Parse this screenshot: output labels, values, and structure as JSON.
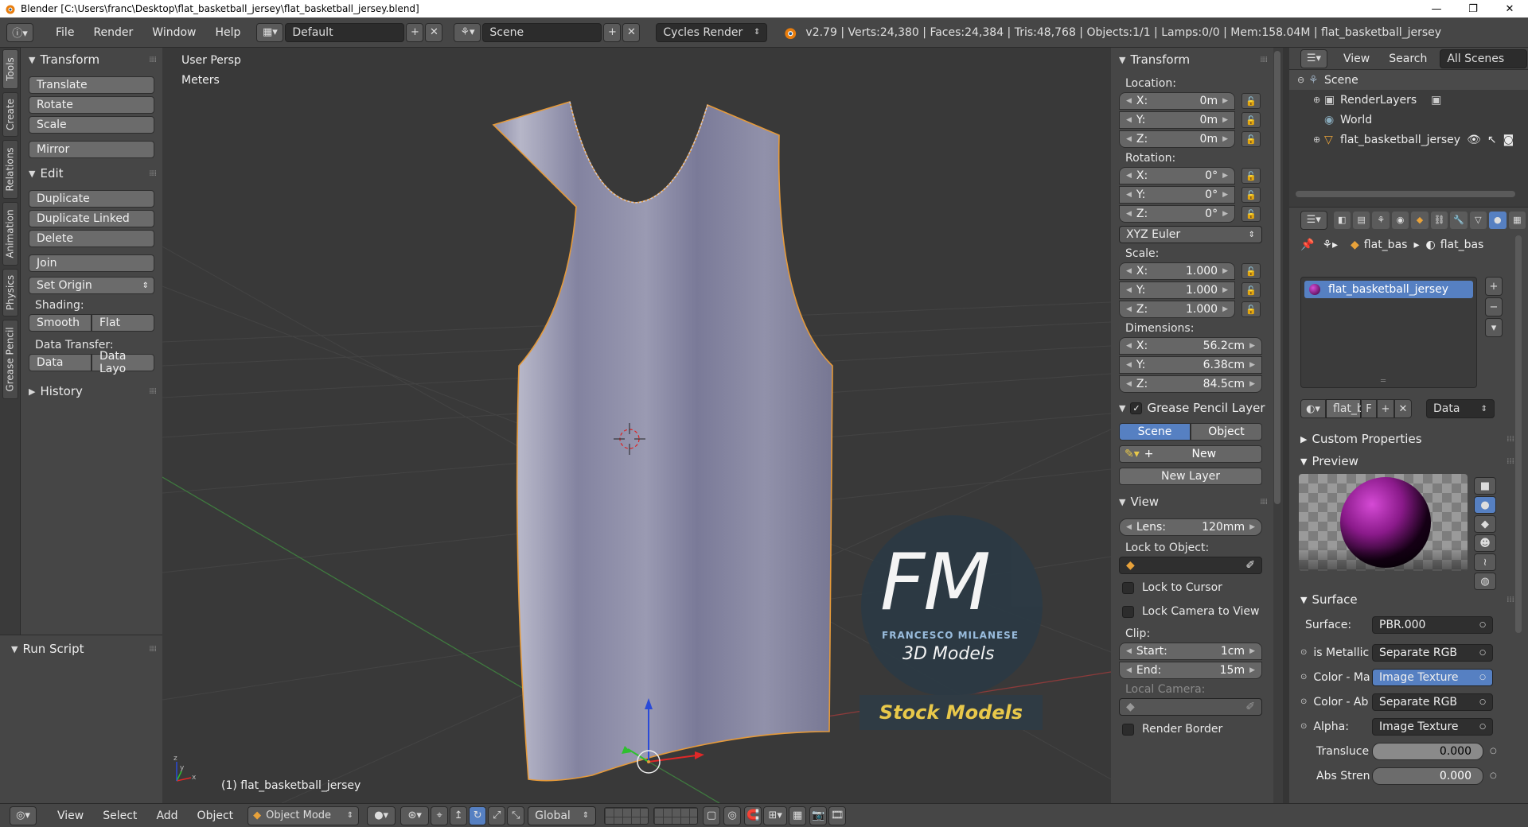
{
  "window": {
    "title": "Blender [C:\\Users\\franc\\Desktop\\flat_basketball_jersey\\flat_basketball_jersey.blend]",
    "minimize": "—",
    "maximize": "❐",
    "close": "✕"
  },
  "info_header": {
    "menus": [
      "File",
      "Render",
      "Window",
      "Help"
    ],
    "layout": "Default",
    "scene": "Scene",
    "engine": "Cycles Render",
    "stats": "v2.79 | Verts:24,380 | Faces:24,384 | Tris:48,768 | Objects:1/1 | Lamps:0/0 | Mem:158.04M | flat_basketball_jersey"
  },
  "tool_tabs": [
    "Tools",
    "Create",
    "Relations",
    "Animation",
    "Physics",
    "Grease Pencil"
  ],
  "tool_shelf": {
    "transform": {
      "title": "Transform",
      "buttons": [
        "Translate",
        "Rotate",
        "Scale"
      ],
      "mirror": "Mirror"
    },
    "edit": {
      "title": "Edit",
      "duplicate": "Duplicate",
      "duplicate_linked": "Duplicate Linked",
      "delete": "Delete",
      "join": "Join",
      "set_origin": "Set Origin",
      "shading_label": "Shading:",
      "smooth": "Smooth",
      "flat": "Flat",
      "data_transfer_label": "Data Transfer:",
      "data": "Data",
      "data_layout": "Data Layo"
    },
    "history": "History",
    "run_script": "Run Script"
  },
  "viewport": {
    "view_name": "User Persp",
    "units": "Meters",
    "object_label": "(1) flat_basketball_jersey",
    "watermark_letters": "FM",
    "watermark_name": "FRANCESCO MILANESE",
    "watermark_sub": "3D Models",
    "watermark_banner": "Stock Models"
  },
  "n_panel": {
    "transform_title": "Transform",
    "location_label": "Location:",
    "location": [
      {
        "k": "X:",
        "v": "0m"
      },
      {
        "k": "Y:",
        "v": "0m"
      },
      {
        "k": "Z:",
        "v": "0m"
      }
    ],
    "rotation_label": "Rotation:",
    "rotation": [
      {
        "k": "X:",
        "v": "0°"
      },
      {
        "k": "Y:",
        "v": "0°"
      },
      {
        "k": "Z:",
        "v": "0°"
      }
    ],
    "rotation_mode": "XYZ Euler",
    "scale_label": "Scale:",
    "scale": [
      {
        "k": "X:",
        "v": "1.000"
      },
      {
        "k": "Y:",
        "v": "1.000"
      },
      {
        "k": "Z:",
        "v": "1.000"
      }
    ],
    "dimensions_label": "Dimensions:",
    "dimensions": [
      {
        "k": "X:",
        "v": "56.2cm"
      },
      {
        "k": "Y:",
        "v": "6.38cm"
      },
      {
        "k": "Z:",
        "v": "84.5cm"
      }
    ],
    "grease_title": "Grease Pencil Layer",
    "scene_btn": "Scene",
    "object_btn": "Object",
    "new_btn": "New",
    "new_layer": "New Layer",
    "view_title": "View",
    "lens_label": "Lens:",
    "lens_value": "120mm",
    "lock_object": "Lock to Object:",
    "lock_cursor": "Lock to Cursor",
    "lock_camera": "Lock Camera to View",
    "clip_label": "Clip:",
    "clip_start_label": "Start:",
    "clip_start": "1cm",
    "clip_end_label": "End:",
    "clip_end": "15m",
    "local_camera": "Local Camera:",
    "render_border": "Render Border"
  },
  "outliner": {
    "view": "View",
    "search": "Search",
    "filter": "All Scenes",
    "items": {
      "scene": "Scene",
      "render_layers": "RenderLayers",
      "world": "World",
      "object": "flat_basketball_jersey"
    }
  },
  "properties": {
    "breadcrumb_obj": "flat_bas",
    "breadcrumb_mat": "flat_bas",
    "material_slot": "flat_basketball_jersey",
    "mat_name_short": "flat_b",
    "fake_user": "F",
    "link": "Data",
    "custom_props": "Custom Properties",
    "preview": "Preview",
    "surface_panel": "Surface",
    "surface_label": "Surface:",
    "surface_value": "PBR.000",
    "rows": [
      {
        "label": "is Metallic",
        "value": "Separate RGB",
        "hl": false
      },
      {
        "label": "Color - Ma",
        "value": "Image Texture",
        "hl": true
      },
      {
        "label": "Color - Ab",
        "value": "Separate RGB",
        "hl": false
      },
      {
        "label": "Alpha:",
        "value": "Image Texture",
        "hl": false
      }
    ],
    "translucence_label": "Transluce",
    "translucence": "0.000",
    "abs_label": "Abs Stren",
    "abs": "0.000"
  },
  "bottom_header": {
    "menus": [
      "View",
      "Select",
      "Add",
      "Object"
    ],
    "mode": "Object Mode",
    "orientation": "Global"
  },
  "colors": {
    "accent_blue": "#5680c2",
    "panel_bg": "#464646",
    "viewport_bg": "#393939",
    "watermark_banner_text": "#e8c84a"
  }
}
